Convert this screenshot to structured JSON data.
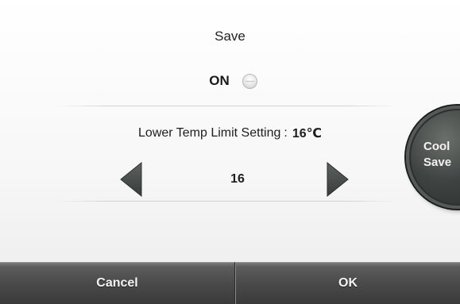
{
  "screen": {
    "title": "Save"
  },
  "toggle": {
    "label": "ON",
    "state": "off"
  },
  "setting": {
    "label": "Lower Temp Limit Setting",
    "separator": ":",
    "value_display": "16℃"
  },
  "stepper": {
    "value": "16",
    "decrement_icon": "left-triangle-icon",
    "increment_icon": "right-triangle-icon"
  },
  "side_button": {
    "line1": "Cool",
    "line2": "Save"
  },
  "bottom_bar": {
    "cancel_label": "Cancel",
    "ok_label": "OK"
  },
  "colors": {
    "arrow": "#4a4f4d",
    "bar": "#4a4a4a",
    "side_button": "#3f4442"
  }
}
